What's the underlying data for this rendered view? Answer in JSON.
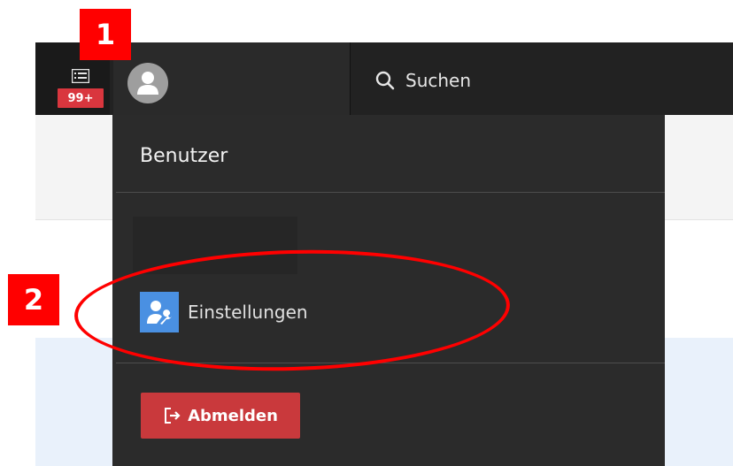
{
  "notifications": {
    "badge": "99+",
    "icon": "list-icon",
    "badge_color": "#d9363e"
  },
  "user": {
    "avatar_icon": "user-avatar-icon"
  },
  "search": {
    "label": "Suchen",
    "icon": "search-icon"
  },
  "dropdown": {
    "title": "Benutzer",
    "settings": {
      "label": "Einstellungen",
      "icon": "user-settings-icon",
      "icon_color": "#4a90e2"
    },
    "logout": {
      "label": "Abmelden",
      "icon": "logout-icon",
      "color": "#c9393c"
    }
  },
  "annotations": [
    {
      "label": "1",
      "color": "#ff0000"
    },
    {
      "label": "2",
      "color": "#ff0000"
    }
  ]
}
